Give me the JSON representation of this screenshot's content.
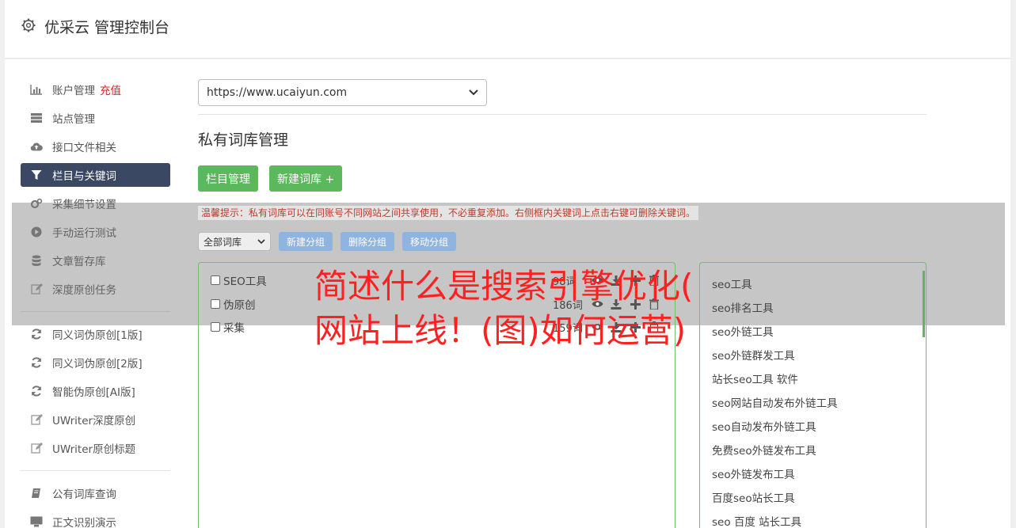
{
  "header": {
    "title": "优采云 管理控制台",
    "icon": "gear-icon"
  },
  "sidebar": {
    "items": [
      {
        "label": "账户管理",
        "badge": "充值",
        "icon": "bar-chart-icon"
      },
      {
        "label": "站点管理",
        "icon": "server-icon"
      },
      {
        "label": "接口文件相关",
        "icon": "cloud-upload-icon"
      },
      {
        "label": "栏目与关键词",
        "icon": "filter-icon",
        "active": true
      },
      {
        "label": "采集细节设置",
        "icon": "cogs-icon"
      },
      {
        "label": "手动运行测试",
        "icon": "play-circle-icon"
      },
      {
        "label": "文章暂存库",
        "icon": "database-icon"
      },
      {
        "label": "深度原创任务",
        "icon": "edit-icon"
      }
    ],
    "items2": [
      {
        "label": "同义词伪原创[1版]",
        "icon": "refresh-icon"
      },
      {
        "label": "同义词伪原创[2版]",
        "icon": "refresh-icon"
      },
      {
        "label": "智能伪原创[AI版]",
        "icon": "refresh-icon"
      },
      {
        "label": "UWriter深度原创",
        "icon": "edit-icon"
      },
      {
        "label": "UWriter原创标题",
        "icon": "edit-icon"
      }
    ],
    "items3": [
      {
        "label": "公有词库查询",
        "icon": "book-icon"
      },
      {
        "label": "正文识别演示",
        "icon": "monitor-icon"
      }
    ]
  },
  "main": {
    "site_select": "https://www.ucaiyun.com",
    "section_title": "私有词库管理",
    "btn_column": "栏目管理",
    "btn_new_lib": "新建词库 +",
    "tip": "温馨提示：私有词库可以在同账号不同网站之间共享使用，不必重复添加。右侧框内关键词上点击右键可删除关键词。",
    "group_select": "全部词库",
    "btn_new_group": "新建分组",
    "btn_del_group": "删除分组",
    "btn_move_group": "移动分组"
  },
  "libraries": [
    {
      "name": "SEO工具",
      "count": "98词"
    },
    {
      "name": "伪原创",
      "count": "186词"
    },
    {
      "name": "采集",
      "count": "159词"
    }
  ],
  "keywords": [
    "seo工具",
    "seo排名工具",
    "seo外链工具",
    "seo外链群发工具",
    "站长seo工具 软件",
    "seo网站自动发布外链工具",
    "seo自动发布外链工具",
    "免费seo外链发布工具",
    "seo外链发布工具",
    "百度seo站长工具",
    "seo 百度 站长工具"
  ],
  "overlay_title": {
    "line1": "简述什么是搜索引擎优化(",
    "line2": "网站上线！(图)如何运营)"
  },
  "colors": {
    "accent_green": "#5cb85c",
    "active_nav": "#3b4863",
    "overlay_red": "#ff2020",
    "blue_btn": "#8fb4e0"
  }
}
